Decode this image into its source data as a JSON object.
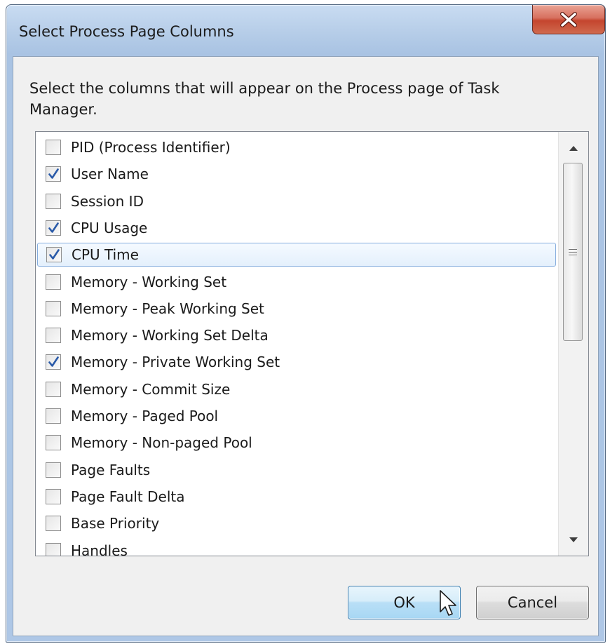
{
  "window": {
    "title": "Select Process Page Columns",
    "close_label": "X"
  },
  "description": "Select the columns that will appear on the Process page of Task Manager.",
  "columns": [
    {
      "label": "PID (Process Identifier)",
      "checked": false,
      "selected": false
    },
    {
      "label": "User Name",
      "checked": true,
      "selected": false
    },
    {
      "label": "Session ID",
      "checked": false,
      "selected": false
    },
    {
      "label": "CPU Usage",
      "checked": true,
      "selected": false
    },
    {
      "label": "CPU Time",
      "checked": true,
      "selected": true
    },
    {
      "label": "Memory - Working Set",
      "checked": false,
      "selected": false
    },
    {
      "label": "Memory - Peak Working Set",
      "checked": false,
      "selected": false
    },
    {
      "label": "Memory - Working Set Delta",
      "checked": false,
      "selected": false
    },
    {
      "label": "Memory - Private Working Set",
      "checked": true,
      "selected": false
    },
    {
      "label": "Memory - Commit Size",
      "checked": false,
      "selected": false
    },
    {
      "label": "Memory - Paged Pool",
      "checked": false,
      "selected": false
    },
    {
      "label": "Memory - Non-paged Pool",
      "checked": false,
      "selected": false
    },
    {
      "label": "Page Faults",
      "checked": false,
      "selected": false
    },
    {
      "label": "Page Fault Delta",
      "checked": false,
      "selected": false
    },
    {
      "label": "Base Priority",
      "checked": false,
      "selected": false
    },
    {
      "label": "Handles",
      "checked": false,
      "selected": false
    }
  ],
  "buttons": {
    "ok_label": "OK",
    "cancel_label": "Cancel"
  },
  "colors": {
    "title_bar": "#b6cde8",
    "close_button": "#c4452e",
    "check_mark": "#2a5aa8",
    "selection_border": "#84acdd",
    "ok_button": "#b9dff6"
  },
  "icons": {
    "close": "close-icon",
    "check": "checkmark-icon",
    "scroll_up": "arrow-up-icon",
    "scroll_down": "arrow-down-icon",
    "cursor": "mouse-pointer-icon"
  }
}
